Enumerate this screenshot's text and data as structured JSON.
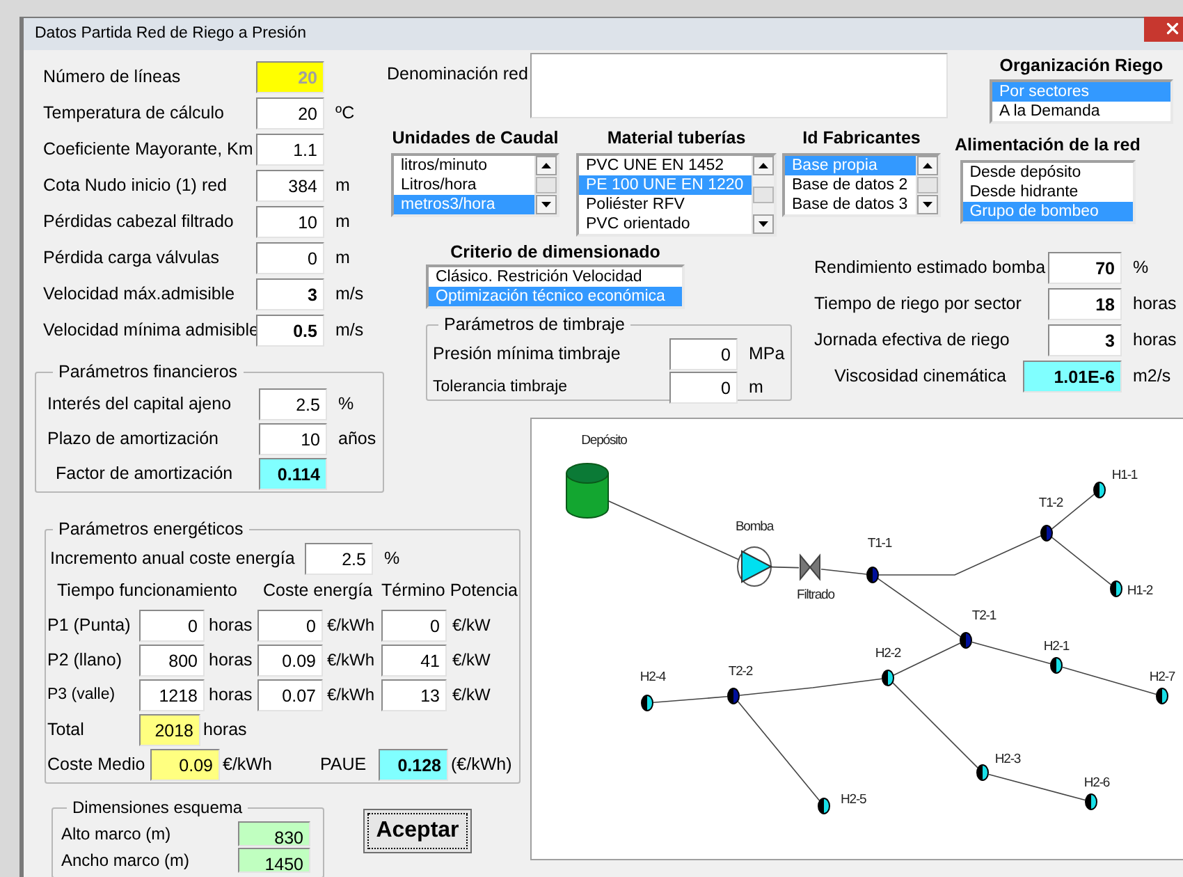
{
  "window": {
    "title": "Datos Partida Red de Riego a Presión"
  },
  "general": [
    {
      "label": "Número de líneas",
      "value": "20",
      "kind": "locked",
      "bold": true
    },
    {
      "label": "Temperatura de cálculo",
      "value": "20",
      "unit": "ºC",
      "kind": "input",
      "bold": false
    },
    {
      "label": "Coeficiente Mayorante, Km",
      "value": "1.1",
      "kind": "input",
      "bold": false
    },
    {
      "label": "Cota Nudo inicio (1) red",
      "value": "384",
      "unit": "m",
      "kind": "input",
      "bold": false
    },
    {
      "label": "Pérdidas cabezal filtrado",
      "value": "10",
      "unit": "m",
      "kind": "input",
      "bold": false
    },
    {
      "label": "Pérdida carga válvulas",
      "value": "0",
      "unit": "m",
      "kind": "input",
      "bold": false
    },
    {
      "label": "Velocidad máx.admisible",
      "value": "3",
      "unit": "m/s",
      "kind": "input",
      "bold": true
    },
    {
      "label": "Velocidad mínima admisible",
      "value": "0.5",
      "unit": "m/s",
      "kind": "input",
      "bold": true
    }
  ],
  "network_name": {
    "label": "Denominación red"
  },
  "organization": {
    "title": "Organización Riego",
    "items": [
      {
        "label": "Por sectores",
        "selected": true
      },
      {
        "label": "A la Demanda",
        "selected": false
      }
    ]
  },
  "lists": [
    {
      "title": "Unidades de Caudal",
      "kind": "scroll",
      "items": [
        {
          "label": "litros/minuto",
          "selected": false
        },
        {
          "label": "Litros/hora",
          "selected": false
        },
        {
          "label": "metros3/hora",
          "selected": true
        }
      ]
    },
    {
      "title": "Material tuberías",
      "kind": "scroll",
      "items": [
        {
          "label": "PVC UNE EN 1452",
          "selected": false
        },
        {
          "label": "PE 100 UNE EN 1220",
          "selected": true
        },
        {
          "label": "Poliéster RFV",
          "selected": false
        },
        {
          "label": "PVC orientado",
          "selected": false
        }
      ]
    },
    {
      "title": "Id Fabricantes",
      "kind": "scroll",
      "items": [
        {
          "label": "Base propia",
          "selected": true
        },
        {
          "label": "Base de datos 2",
          "selected": false
        },
        {
          "label": "Base de datos 3",
          "selected": false
        }
      ]
    },
    {
      "title": "Alimentación de la red",
      "kind": "plain",
      "items": [
        {
          "label": "Desde depósito",
          "selected": false
        },
        {
          "label": "Desde hidrante",
          "selected": false
        },
        {
          "label": "Grupo de bombeo",
          "selected": true
        }
      ]
    }
  ],
  "criterion": {
    "title": "Criterio de dimensionado",
    "items": [
      {
        "label": "Clásico. Restrición Velocidad",
        "selected": false
      },
      {
        "label": "Optimización técnico económica",
        "selected": true
      }
    ]
  },
  "rating": {
    "title": "Parámetros de timbraje",
    "fields": [
      {
        "label": "Presión mínima timbraje",
        "value": "0",
        "unit": "MPa",
        "kind": "input",
        "bold": false
      },
      {
        "label": "Tolerancia timbraje",
        "value": "0",
        "unit": "m",
        "kind": "input",
        "bold": false
      }
    ]
  },
  "pump_fields": [
    {
      "label": "Rendimiento estimado bomba",
      "value": "70",
      "unit": "%",
      "kind": "input",
      "bold": true
    },
    {
      "label": "Tiempo de riego por sector",
      "value": "18",
      "unit": "horas",
      "kind": "input",
      "bold": true
    },
    {
      "label": "Jornada efectiva de riego",
      "value": "3",
      "unit": "horas",
      "kind": "input",
      "bold": true
    },
    {
      "label": "Viscosidad cinemática",
      "value": "1.01E-6",
      "unit": "m2/s",
      "kind": "result",
      "bold": true
    }
  ],
  "financial": {
    "title": "Parámetros financieros",
    "fields": [
      {
        "label": "Interés del capital ajeno",
        "value": "2.5",
        "unit": "%",
        "kind": "input",
        "bold": false
      },
      {
        "label": "Plazo de amortización",
        "value": "10",
        "unit": "años",
        "kind": "input",
        "bold": false
      },
      {
        "label": "Factor de amortización",
        "value": "0.114",
        "kind": "result",
        "bold": true
      }
    ]
  },
  "energy": {
    "title": "Parámetros energéticos",
    "increment": {
      "label": "Incremento anual coste energía",
      "value": "2.5",
      "unit": "%",
      "kind": "input",
      "bold": false
    },
    "headers": [
      "Tiempo funcionamiento",
      "Coste energía",
      "Término Potencia"
    ],
    "periods": [
      {
        "label": "P1 (Punta)",
        "hours": "0",
        "hours_unit": "horas",
        "cost": "0",
        "cost_unit": "€/kWh",
        "power": "0",
        "power_unit": "€/kW"
      },
      {
        "label": "P2 (llano)",
        "hours": "800",
        "hours_unit": "horas",
        "cost": "0.09",
        "cost_unit": "€/kWh",
        "power": "41",
        "power_unit": "€/kW"
      },
      {
        "label": "P3 (valle)",
        "hours": "1218",
        "hours_unit": "horas",
        "cost": "0.07",
        "cost_unit": "€/kWh",
        "power": "13",
        "power_unit": "€/kW"
      }
    ],
    "total": {
      "label": "Total",
      "value": "2018",
      "unit": "horas",
      "kind": "subtotal",
      "bold": false
    },
    "average": {
      "label": "Coste Medio",
      "value": "0.09",
      "unit": "€/kWh",
      "kind": "subtotal",
      "bold": false
    },
    "paue": {
      "label": "PAUE",
      "value": "0.128",
      "unit": "(€/kWh)",
      "kind": "result",
      "bold": true
    }
  },
  "dimensions": {
    "title": "Dimensiones esquema",
    "fields": [
      {
        "label": "Alto marco (m)",
        "value": "830",
        "kind": "dimension",
        "bold": false
      },
      {
        "label": "Ancho marco (m)",
        "value": "1450",
        "kind": "dimension",
        "bold": false
      }
    ]
  },
  "accept_button": "Aceptar",
  "diagram": {
    "nodes": [
      {
        "label": "Depósito",
        "kind": "tank"
      },
      {
        "label": "Bomba",
        "kind": "pump"
      },
      {
        "label": "Filtrado",
        "kind": "valve"
      },
      {
        "label": "T1-1",
        "kind": "junction"
      },
      {
        "label": "T1-2",
        "kind": "junction"
      },
      {
        "label": "H1-1",
        "kind": "hydrant"
      },
      {
        "label": "H1-2",
        "kind": "hydrant"
      },
      {
        "label": "T2-1",
        "kind": "junction"
      },
      {
        "label": "H2-1",
        "kind": "hydrant"
      },
      {
        "label": "H2-7",
        "kind": "hydrant"
      },
      {
        "label": "H2-2",
        "kind": "hydrant"
      },
      {
        "label": "T2-2",
        "kind": "junction"
      },
      {
        "label": "H2-4",
        "kind": "hydrant"
      },
      {
        "label": "H2-5",
        "kind": "hydrant"
      },
      {
        "label": "H2-3",
        "kind": "hydrant"
      },
      {
        "label": "H2-6",
        "kind": "hydrant"
      }
    ]
  }
}
